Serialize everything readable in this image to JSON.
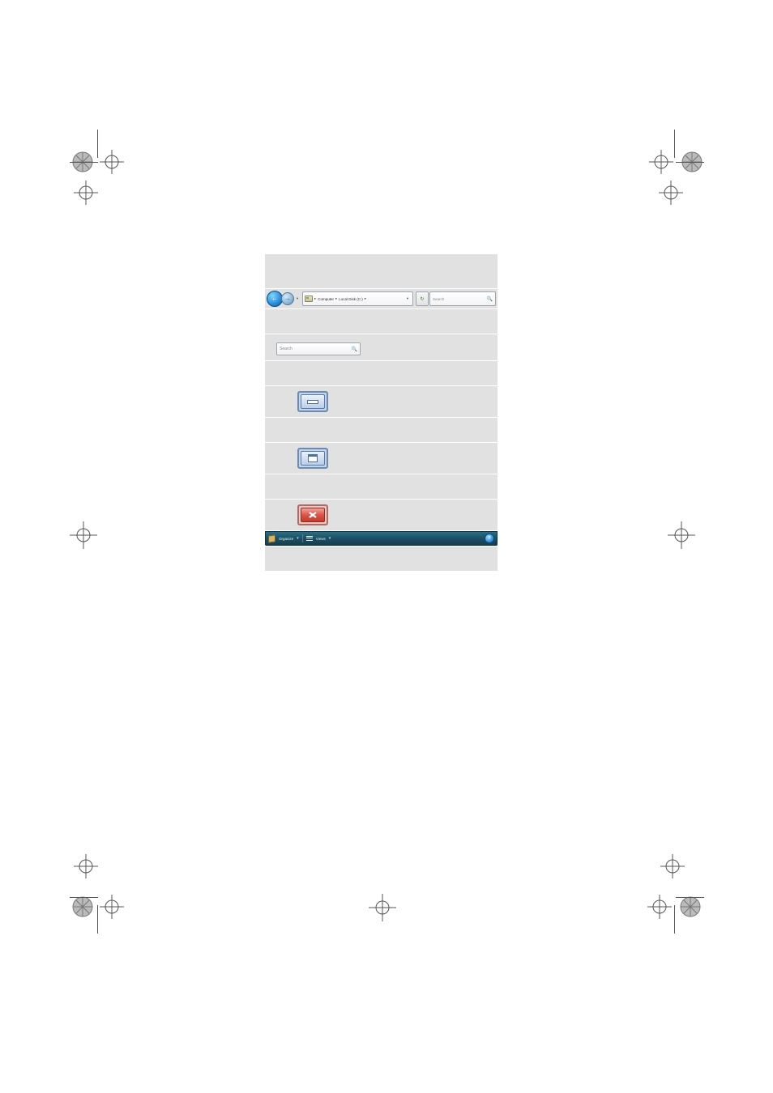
{
  "address_bar": {
    "crumb1": "Computer",
    "crumb2": "Local Disk (C:)",
    "search_placeholder": "Search"
  },
  "standalone_search": {
    "placeholder": "Search"
  },
  "command_bar": {
    "organize": "Organize",
    "views": "Views"
  }
}
